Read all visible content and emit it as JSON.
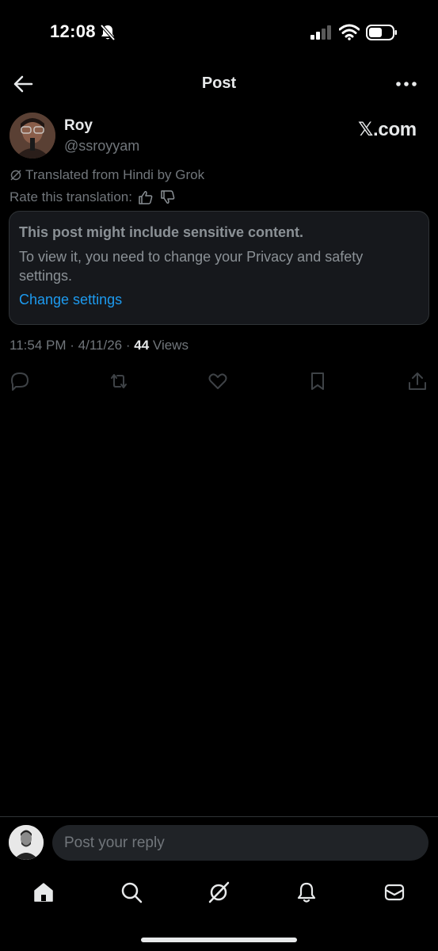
{
  "status_bar": {
    "time": "12:08",
    "icons": [
      "bell-off-icon",
      "cellular-signal-icon",
      "wifi-icon",
      "battery-icon"
    ]
  },
  "header": {
    "title": "Post",
    "back_icon": "arrow-left-icon",
    "more_icon": "more-horizontal-icon"
  },
  "post": {
    "author": {
      "name": "Roy",
      "handle": "@ssroyyam"
    },
    "watermark": "𝕏.com",
    "translation_note": "Translated from Hindi by Grok",
    "rate_translation_label": "Rate this translation:",
    "sensitive": {
      "title": "This post might include sensitive content.",
      "body": "To view it, you need to change your Privacy and safety settings.",
      "link": "Change settings"
    },
    "time": "11:54 PM",
    "separator": "·",
    "date": "4/11/26",
    "views_count": "44",
    "views_label": "Views",
    "actions": [
      "reply-icon",
      "repost-icon",
      "like-icon",
      "bookmark-icon",
      "share-icon"
    ]
  },
  "reply": {
    "placeholder": "Post your reply"
  },
  "bottom_nav": [
    "home-icon",
    "search-icon",
    "grok-icon",
    "notifications-icon",
    "messages-icon"
  ],
  "colors": {
    "background": "#000000",
    "text_primary": "#e7e9ea",
    "text_secondary": "#71767b",
    "link": "#1d9bf0",
    "card_bg": "#16181c",
    "border": "#2f3336"
  }
}
